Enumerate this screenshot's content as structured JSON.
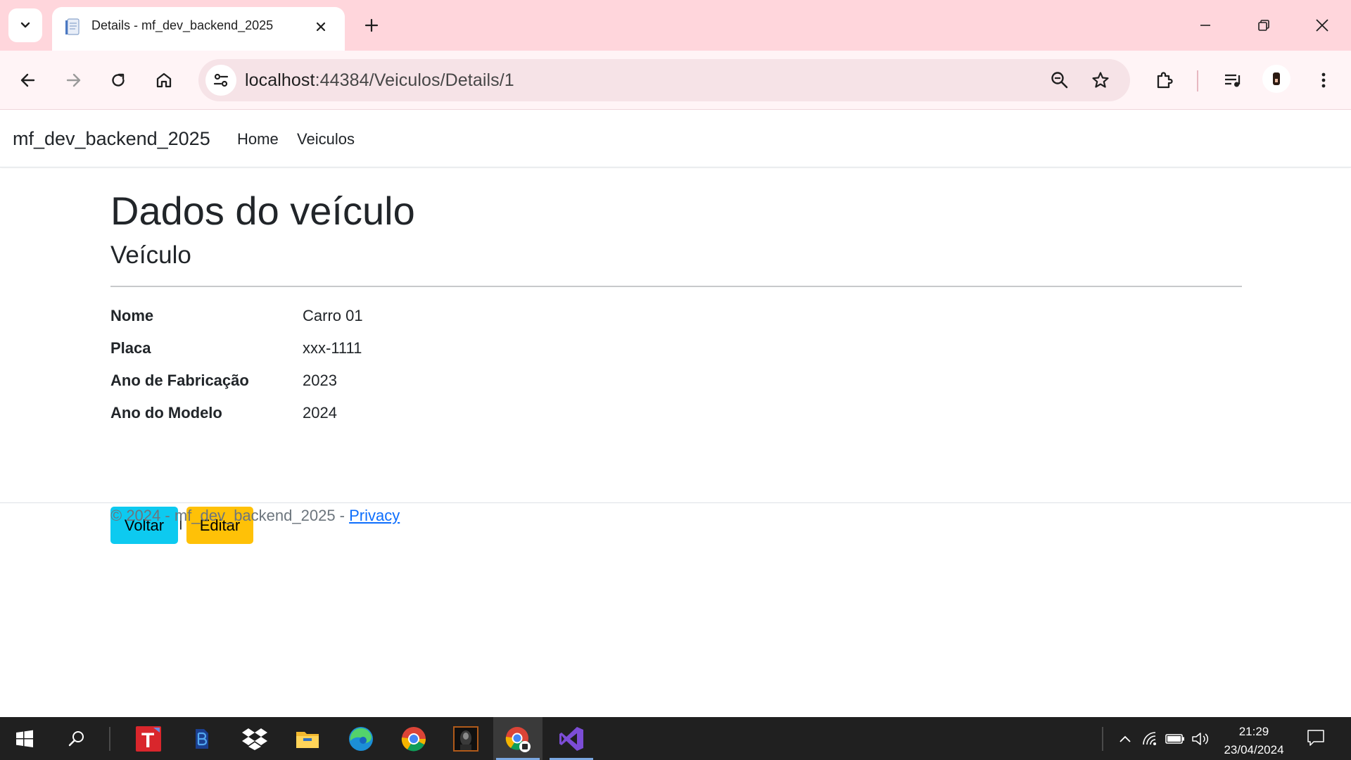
{
  "browser": {
    "tab_title": "Details - mf_dev_backend_2025",
    "url_host": "localhost",
    "url_path": ":44384/Veiculos/Details/1",
    "icons": [
      "chevron-down-icon",
      "document-icon",
      "close-icon",
      "plus-icon",
      "minimize-icon",
      "restore-icon",
      "close-icon",
      "back-icon",
      "forward-icon",
      "reload-icon",
      "home-icon",
      "site-settings-icon",
      "zoom-icon",
      "star-icon",
      "extensions-icon",
      "media-icon",
      "profile-avatar",
      "kebab-menu-icon"
    ]
  },
  "site": {
    "brand": "mf_dev_backend_2025",
    "nav": [
      "Home",
      "Veiculos"
    ]
  },
  "page": {
    "title": "Dados do veículo",
    "subtitle": "Veículo",
    "fields": [
      {
        "label": "Nome",
        "value": "Carro 01"
      },
      {
        "label": "Placa",
        "value": "xxx-1111"
      },
      {
        "label": "Ano de Fabricação",
        "value": "2023"
      },
      {
        "label": "Ano do Modelo",
        "value": "2024"
      }
    ],
    "back_button": "Voltar",
    "separator": "|",
    "edit_button": "Editar"
  },
  "footer": {
    "text": "© 2024 - mf_dev_backend_2025 - ",
    "privacy_link": "Privacy"
  },
  "taskbar": {
    "time": "21:29",
    "date": "23/04/2024",
    "apps": [
      "start-icon",
      "search-icon",
      "todoist-icon",
      "azure-data-studio-icon",
      "dropbox-icon",
      "file-explorer-icon",
      "edge-icon",
      "chrome-icon",
      "terminal-app-icon",
      "chrome-active-icon",
      "visual-studio-icon"
    ],
    "accent": "#7aa7e0"
  },
  "colors": {
    "tabbar": "#ffd6dc",
    "toolbar": "#fff4f6",
    "btn_info": "#0dcaf0",
    "btn_warning": "#ffc107",
    "link": "#0d6efd"
  }
}
